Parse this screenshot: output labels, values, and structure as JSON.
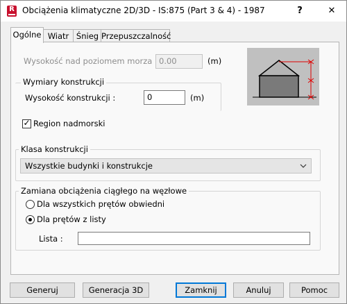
{
  "window": {
    "title": "Obciążenia klimatyczne 2D/3D - IS:875 (Part 3 & 4) - 1987",
    "app_icon_letter": "R",
    "help_label": "?",
    "close_label": "✕"
  },
  "tabs": [
    {
      "label": "Ogólne",
      "active": true
    },
    {
      "label": "Wiatr",
      "active": false
    },
    {
      "label": "Śnieg",
      "active": false
    },
    {
      "label": "Przepuszczalność",
      "active": false
    }
  ],
  "altitude": {
    "label": "Wysokość nad poziomem morza :",
    "value": "0.00",
    "unit": "(m)",
    "enabled": false
  },
  "dimensions": {
    "group_title": "Wymiary konstrukcji",
    "height_label": "Wysokość konstrukcji :",
    "height_value": "0",
    "unit": "(m)"
  },
  "coastal_region": {
    "label": "Region nadmorski",
    "checked": true
  },
  "structure_class": {
    "group_title": "Klasa konstrukcji",
    "selected": "Wszystkie budynki i konstrukcje"
  },
  "conversion": {
    "group_title": "Zamiana obciążenia ciągłego na węzłowe",
    "option_all": "Dla wszystkich prętów obwiedni",
    "option_list": "Dla prętów z listy",
    "selected": "list",
    "list_label": "Lista :",
    "list_value": ""
  },
  "buttons": {
    "generate": "Generuj",
    "generate_3d": "Generacja 3D",
    "close": "Zamknij",
    "cancel": "Anuluj",
    "help": "Pomoc"
  },
  "colors": {
    "accent": "#0078d7",
    "brand_icon": "#c8102e",
    "dimension_lines": "#e00000"
  },
  "icons": [
    "building-preview-icon",
    "chevron-down-icon",
    "checkmark-icon",
    "close-icon",
    "help-icon"
  ]
}
